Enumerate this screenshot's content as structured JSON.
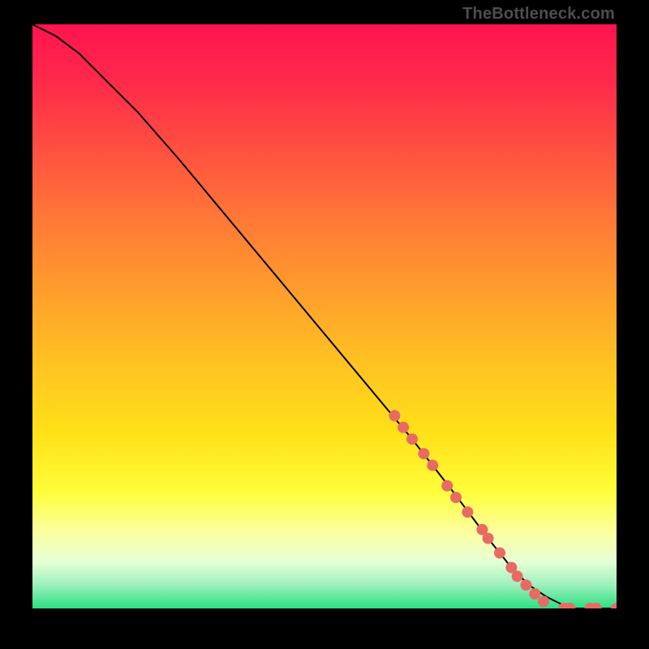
{
  "attribution": "TheBottleneck.com",
  "chart_data": {
    "type": "line",
    "title": "",
    "xlabel": "",
    "ylabel": "",
    "xlim": [
      0,
      100
    ],
    "ylim": [
      0,
      100
    ],
    "grid": false,
    "series": [
      {
        "name": "curve",
        "x": [
          0,
          4,
          8,
          12,
          18,
          25,
          35,
          45,
          55,
          65,
          72,
          78,
          82,
          85,
          88,
          92,
          96,
          100
        ],
        "y": [
          100,
          98,
          95,
          91,
          85,
          77,
          65,
          53,
          41,
          29,
          20,
          12,
          7,
          4,
          2,
          0,
          0,
          0
        ],
        "color": "#000000",
        "stroke_width": 2
      }
    ],
    "markers": {
      "name": "highlight-points",
      "color": "#e86b63",
      "radius": 7,
      "points": [
        {
          "x": 62,
          "y": 33
        },
        {
          "x": 63.5,
          "y": 31
        },
        {
          "x": 65,
          "y": 29
        },
        {
          "x": 67,
          "y": 26.5
        },
        {
          "x": 68.5,
          "y": 24.5
        },
        {
          "x": 71,
          "y": 21
        },
        {
          "x": 72.5,
          "y": 19
        },
        {
          "x": 74.5,
          "y": 16.5
        },
        {
          "x": 77,
          "y": 13.5
        },
        {
          "x": 78,
          "y": 12
        },
        {
          "x": 80,
          "y": 9.5
        },
        {
          "x": 82,
          "y": 7
        },
        {
          "x": 83,
          "y": 5.5
        },
        {
          "x": 84.5,
          "y": 4
        },
        {
          "x": 86,
          "y": 2.5
        },
        {
          "x": 87.5,
          "y": 1.2
        },
        {
          "x": 91,
          "y": 0
        },
        {
          "x": 92,
          "y": 0
        },
        {
          "x": 95.5,
          "y": 0
        },
        {
          "x": 96.5,
          "y": 0
        },
        {
          "x": 100,
          "y": 0
        }
      ]
    }
  }
}
